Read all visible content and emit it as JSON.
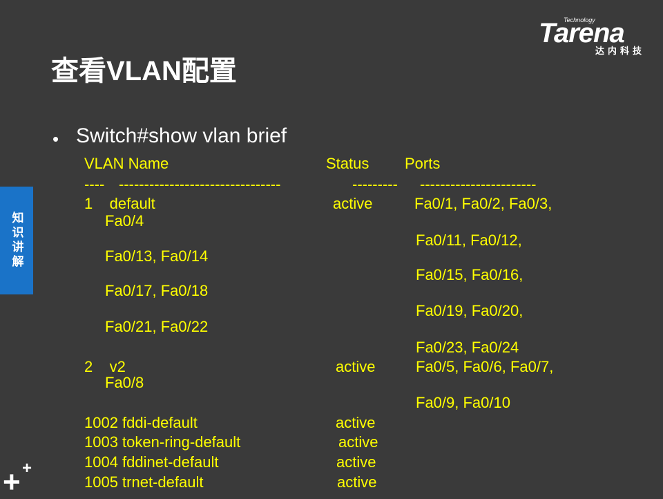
{
  "logo": {
    "technology": "Technology",
    "name": "Tarena",
    "chinese": "达内科技"
  },
  "title": "查看VLAN配置",
  "side_tab": "知识讲解",
  "bullet": "Switch#show vlan brief",
  "output": {
    "header_vlan_name": "VLAN Name",
    "header_status": "Status",
    "header_ports": "Ports",
    "sep1": "----",
    "sep2": "--------------------------------",
    "sep3": "---------",
    "sep4": "-----------------------",
    "r1_id_name": "1    default",
    "r1_status": "active",
    "r1_ports": "Fa0/1, Fa0/2, Fa0/3,",
    "r1_wrap1": "Fa0/4",
    "r1_ports2": "Fa0/11, Fa0/12,",
    "r1_wrap2": "Fa0/13, Fa0/14",
    "r1_ports3": "Fa0/15, Fa0/16,",
    "r1_wrap3": "Fa0/17, Fa0/18",
    "r1_ports4": "Fa0/19, Fa0/20,",
    "r1_wrap4": "Fa0/21, Fa0/22",
    "r1_ports5": "Fa0/23, Fa0/24",
    "r2_id_name": "2    v2",
    "r2_status": "active",
    "r2_ports": "Fa0/5, Fa0/6, Fa0/7,",
    "r2_wrap1": "Fa0/8",
    "r2_ports2": "Fa0/9, Fa0/10",
    "r3_id_name": "1002 fddi-default",
    "r3_status": "active",
    "r4_id_name": "1003 token-ring-default",
    "r4_status": "active",
    "r5_id_name": "1004 fddinet-default",
    "r5_status": "active",
    "r6_id_name": "1005 trnet-default",
    "r6_status": "active"
  }
}
